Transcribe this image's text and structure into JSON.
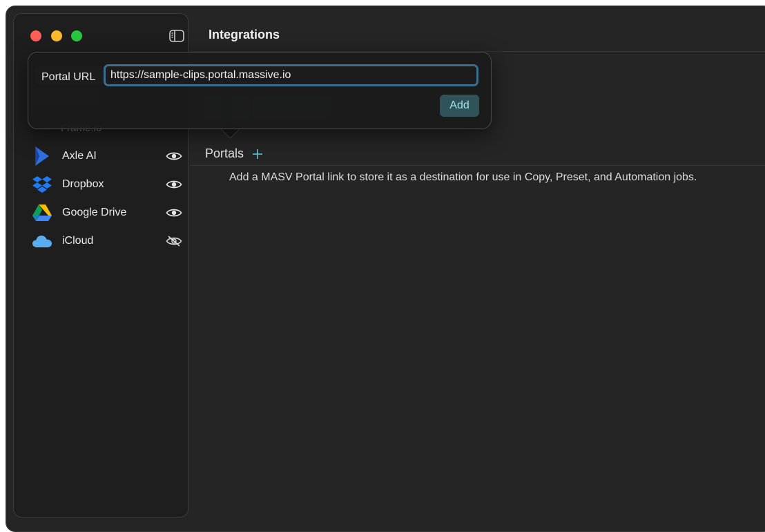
{
  "window": {
    "title": "Integrations"
  },
  "sidebar": {
    "items": [
      {
        "label": "Axle AI",
        "icon": "axle-ai-logo-icon",
        "visibility": "visible-eye-icon"
      },
      {
        "label": "Dropbox",
        "icon": "dropbox-logo-icon",
        "visibility": "visible-eye-icon"
      },
      {
        "label": "Google Drive",
        "icon": "google-drive-logo-icon",
        "visibility": "visible-eye-icon"
      },
      {
        "label": "iCloud",
        "icon": "icloud-logo-icon",
        "visibility": "hidden-eye-slash-icon"
      }
    ],
    "obscured_items": [
      "Frame.io"
    ]
  },
  "main": {
    "portals_label": "Portals",
    "empty_message": "Add a MASV Portal link to store it as a destination for use in Copy, Preset, and Automation jobs."
  },
  "popover": {
    "label": "Portal URL",
    "url_value": "https://sample-clips.portal.massive.io",
    "add_label": "Add"
  },
  "colors": {
    "accent": "#3c6e8e",
    "add_button_bg": "#2f5358",
    "add_button_text": "#9ee3ee",
    "plus_icon": "#5ec6d6"
  }
}
